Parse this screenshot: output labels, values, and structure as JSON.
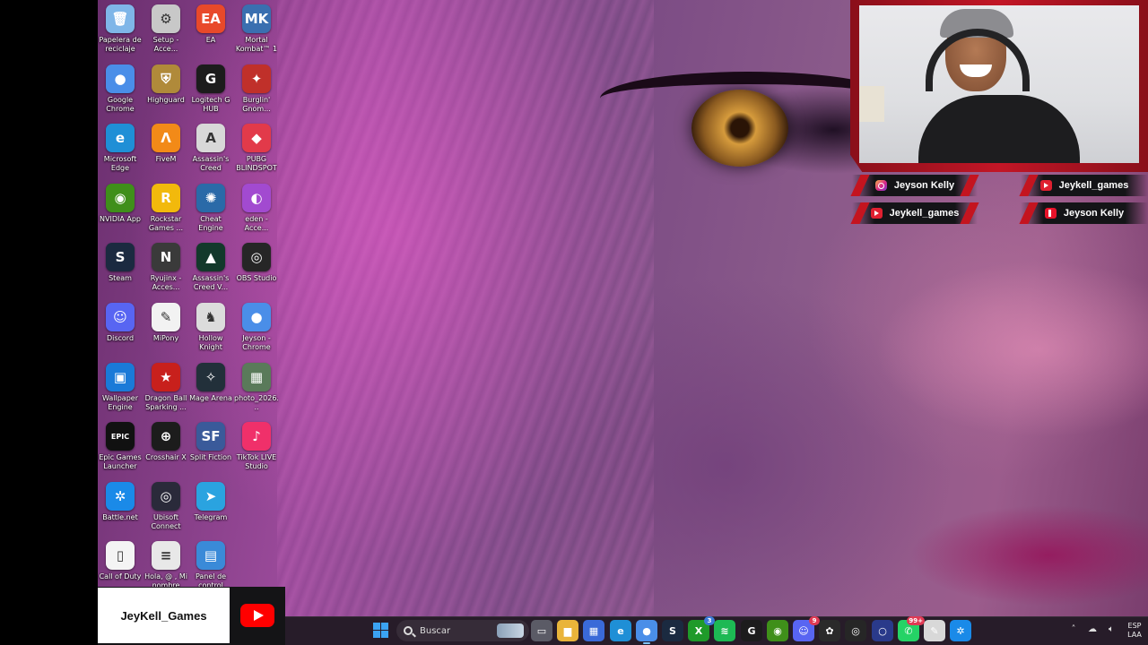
{
  "desktop": {
    "icons": [
      {
        "label": "Papelera de reciclaje",
        "icon": "recycle-bin-icon",
        "color": "#7fb6e8",
        "glyph": "🗑"
      },
      {
        "label": "Setup - Acce...",
        "icon": "setup-icon",
        "color": "#c8c8c8",
        "glyph": "⚙"
      },
      {
        "label": "EA",
        "icon": "ea-icon",
        "color": "#e8492a",
        "glyph": "EA"
      },
      {
        "label": "Mortal Kombat™ 1",
        "icon": "mortal-kombat-icon",
        "color": "#3a6fb0",
        "glyph": "MK"
      },
      {
        "label": "Google Chrome",
        "icon": "chrome-icon",
        "color": "#4a8ee8",
        "glyph": "●"
      },
      {
        "label": "Highguard",
        "icon": "highguard-icon",
        "color": "#b08a3a",
        "glyph": "⛨"
      },
      {
        "label": "Logitech G HUB",
        "icon": "logitech-ghub-icon",
        "color": "#1c1c1c",
        "glyph": "G"
      },
      {
        "label": "Burglin' Gnom...",
        "icon": "burglin-gnomes-icon",
        "color": "#c0302a",
        "glyph": "✦"
      },
      {
        "label": "Microsoft Edge",
        "icon": "edge-icon",
        "color": "#1f8fd6",
        "glyph": "e"
      },
      {
        "label": "FiveM",
        "icon": "fivem-icon",
        "color": "#f28a18",
        "glyph": "Λ"
      },
      {
        "label": "Assassin's Creed",
        "icon": "assassins-creed-icon",
        "color": "#d8d8d8",
        "glyph": "A"
      },
      {
        "label": "PUBG BLINDSPOT",
        "icon": "pubg-blindspot-icon",
        "color": "#e23a4a",
        "glyph": "◆"
      },
      {
        "label": "NVIDIA App",
        "icon": "nvidia-icon",
        "color": "#3f8f1a",
        "glyph": "◉"
      },
      {
        "label": "Rockstar Games ...",
        "icon": "rockstar-icon",
        "color": "#f2b90c",
        "glyph": "R"
      },
      {
        "label": "Cheat Engine",
        "icon": "cheat-engine-icon",
        "color": "#2a6aa8",
        "glyph": "✺"
      },
      {
        "label": "eden - Acce...",
        "icon": "eden-icon",
        "color": "#a24ad0",
        "glyph": "◐"
      },
      {
        "label": "Steam",
        "icon": "steam-icon",
        "color": "#1b2a40",
        "glyph": "S"
      },
      {
        "label": "Ryujinx - Acces...",
        "icon": "ryujinx-icon",
        "color": "#3a3a3a",
        "glyph": "N"
      },
      {
        "label": "Assassin's Creed V...",
        "icon": "assassins-creed-valhalla-icon",
        "color": "#13392b",
        "glyph": "▲"
      },
      {
        "label": "OBS Studio",
        "icon": "obs-icon",
        "color": "#262626",
        "glyph": "◎"
      },
      {
        "label": "Discord",
        "icon": "discord-icon",
        "color": "#5865f2",
        "glyph": "☺"
      },
      {
        "label": "MiPony",
        "icon": "mipony-icon",
        "color": "#f2f2f2",
        "glyph": "✎"
      },
      {
        "label": "Hollow Knight",
        "icon": "hollow-knight-icon",
        "color": "#dcdcdc",
        "glyph": "♞"
      },
      {
        "label": "Jeyson - Chrome",
        "icon": "chrome-profile-icon",
        "color": "#4a8ee8",
        "glyph": "●"
      },
      {
        "label": "Wallpaper Engine",
        "icon": "wallpaper-engine-icon",
        "color": "#1a7ad8",
        "glyph": "▣"
      },
      {
        "label": "Dragon Ball Sparking ...",
        "icon": "dragon-ball-icon",
        "color": "#c8201c",
        "glyph": "★"
      },
      {
        "label": "Mage Arena",
        "icon": "mage-arena-icon",
        "color": "#22303a",
        "glyph": "✧"
      },
      {
        "label": "photo_2026...",
        "icon": "photo-file-icon",
        "color": "#5a7a5a",
        "glyph": "▦"
      },
      {
        "label": "Epic Games Launcher",
        "icon": "epic-games-icon",
        "color": "#111111",
        "glyph": "EPIC"
      },
      {
        "label": "Crosshair X",
        "icon": "crosshair-x-icon",
        "color": "#1c1c1c",
        "glyph": "⊕"
      },
      {
        "label": "Split Fiction",
        "icon": "split-fiction-icon",
        "color": "#3a5a9a",
        "glyph": "SF"
      },
      {
        "label": "TikTok LIVE Studio",
        "icon": "tiktok-live-icon",
        "color": "#f0306a",
        "glyph": "♪"
      },
      {
        "label": "Battle.net",
        "icon": "battlenet-icon",
        "color": "#1a8ae8",
        "glyph": "✲"
      },
      {
        "label": "Ubisoft Connect",
        "icon": "ubisoft-icon",
        "color": "#2a2a3a",
        "glyph": "◎"
      },
      {
        "label": "Telegram",
        "icon": "telegram-icon",
        "color": "#2aa3e0",
        "glyph": "➤"
      },
      {
        "label": "",
        "icon": "empty-slot",
        "color": "transparent",
        "glyph": ""
      },
      {
        "label": "Call of Duty",
        "icon": "call-of-duty-file-icon",
        "color": "#f4f4f4",
        "glyph": "▯"
      },
      {
        "label": "Hola, @ , Mi nombre es...",
        "icon": "text-document-icon",
        "color": "#e8e8e8",
        "glyph": "≡"
      },
      {
        "label": "Panel de control",
        "icon": "control-panel-icon",
        "color": "#3a8ad8",
        "glyph": "▤"
      }
    ]
  },
  "webcam": {
    "description_hidden": ""
  },
  "socials": {
    "left_top": {
      "name": "Jeyson Kelly",
      "icon": "instagram-icon"
    },
    "left_bottom": {
      "name": "Jeykell_games",
      "icon": "youtube-icon"
    },
    "right_top": {
      "name": "Jeykell_games",
      "icon": "youtube-icon"
    },
    "right_bottom": {
      "name": "Jeyson Kelly",
      "icon": "tiktok-icon"
    }
  },
  "banner": {
    "channel_name": "JeyKell_Games",
    "icon": "youtube-logo-icon"
  },
  "taskbar": {
    "search_placeholder": "Buscar",
    "apps": [
      {
        "name": "task-view-icon",
        "color": "#5b5b66",
        "glyph": "▭"
      },
      {
        "name": "file-explorer-icon",
        "color": "#e9b43a",
        "glyph": "▆"
      },
      {
        "name": "microsoft-store-icon",
        "color": "#3a6ad8",
        "glyph": "▦"
      },
      {
        "name": "edge-icon",
        "color": "#1f8fd6",
        "glyph": "e"
      },
      {
        "name": "chrome-icon",
        "color": "#4a8ee8",
        "glyph": "●",
        "active": true
      },
      {
        "name": "steam-icon",
        "color": "#1b2a40",
        "glyph": "S"
      },
      {
        "name": "xbox-icon",
        "color": "#1f9a2a",
        "glyph": "X",
        "badge": "3",
        "badge_color": "blue"
      },
      {
        "name": "spotify-icon",
        "color": "#1db954",
        "glyph": "≋"
      },
      {
        "name": "logitech-ghub-icon",
        "color": "#1c1c1c",
        "glyph": "G"
      },
      {
        "name": "nvidia-icon",
        "color": "#3f8f1a",
        "glyph": "◉"
      },
      {
        "name": "discord-icon",
        "color": "#5865f2",
        "glyph": "☺",
        "badge": "9"
      },
      {
        "name": "chatgpt-icon",
        "color": "#2a2a2a",
        "glyph": "✿"
      },
      {
        "name": "obs-icon",
        "color": "#262626",
        "glyph": "◎"
      },
      {
        "name": "cortana-icon",
        "color": "#2a3a8a",
        "glyph": "○"
      },
      {
        "name": "whatsapp-icon",
        "color": "#25d366",
        "glyph": "✆",
        "badge": "99+"
      },
      {
        "name": "notepad-icon",
        "color": "#d8d8d8",
        "glyph": "✎"
      },
      {
        "name": "battlenet-icon",
        "color": "#1a8ae8",
        "glyph": "✲"
      }
    ],
    "tray": {
      "lang_line1": "ESP",
      "lang_line2": "LAA"
    }
  }
}
